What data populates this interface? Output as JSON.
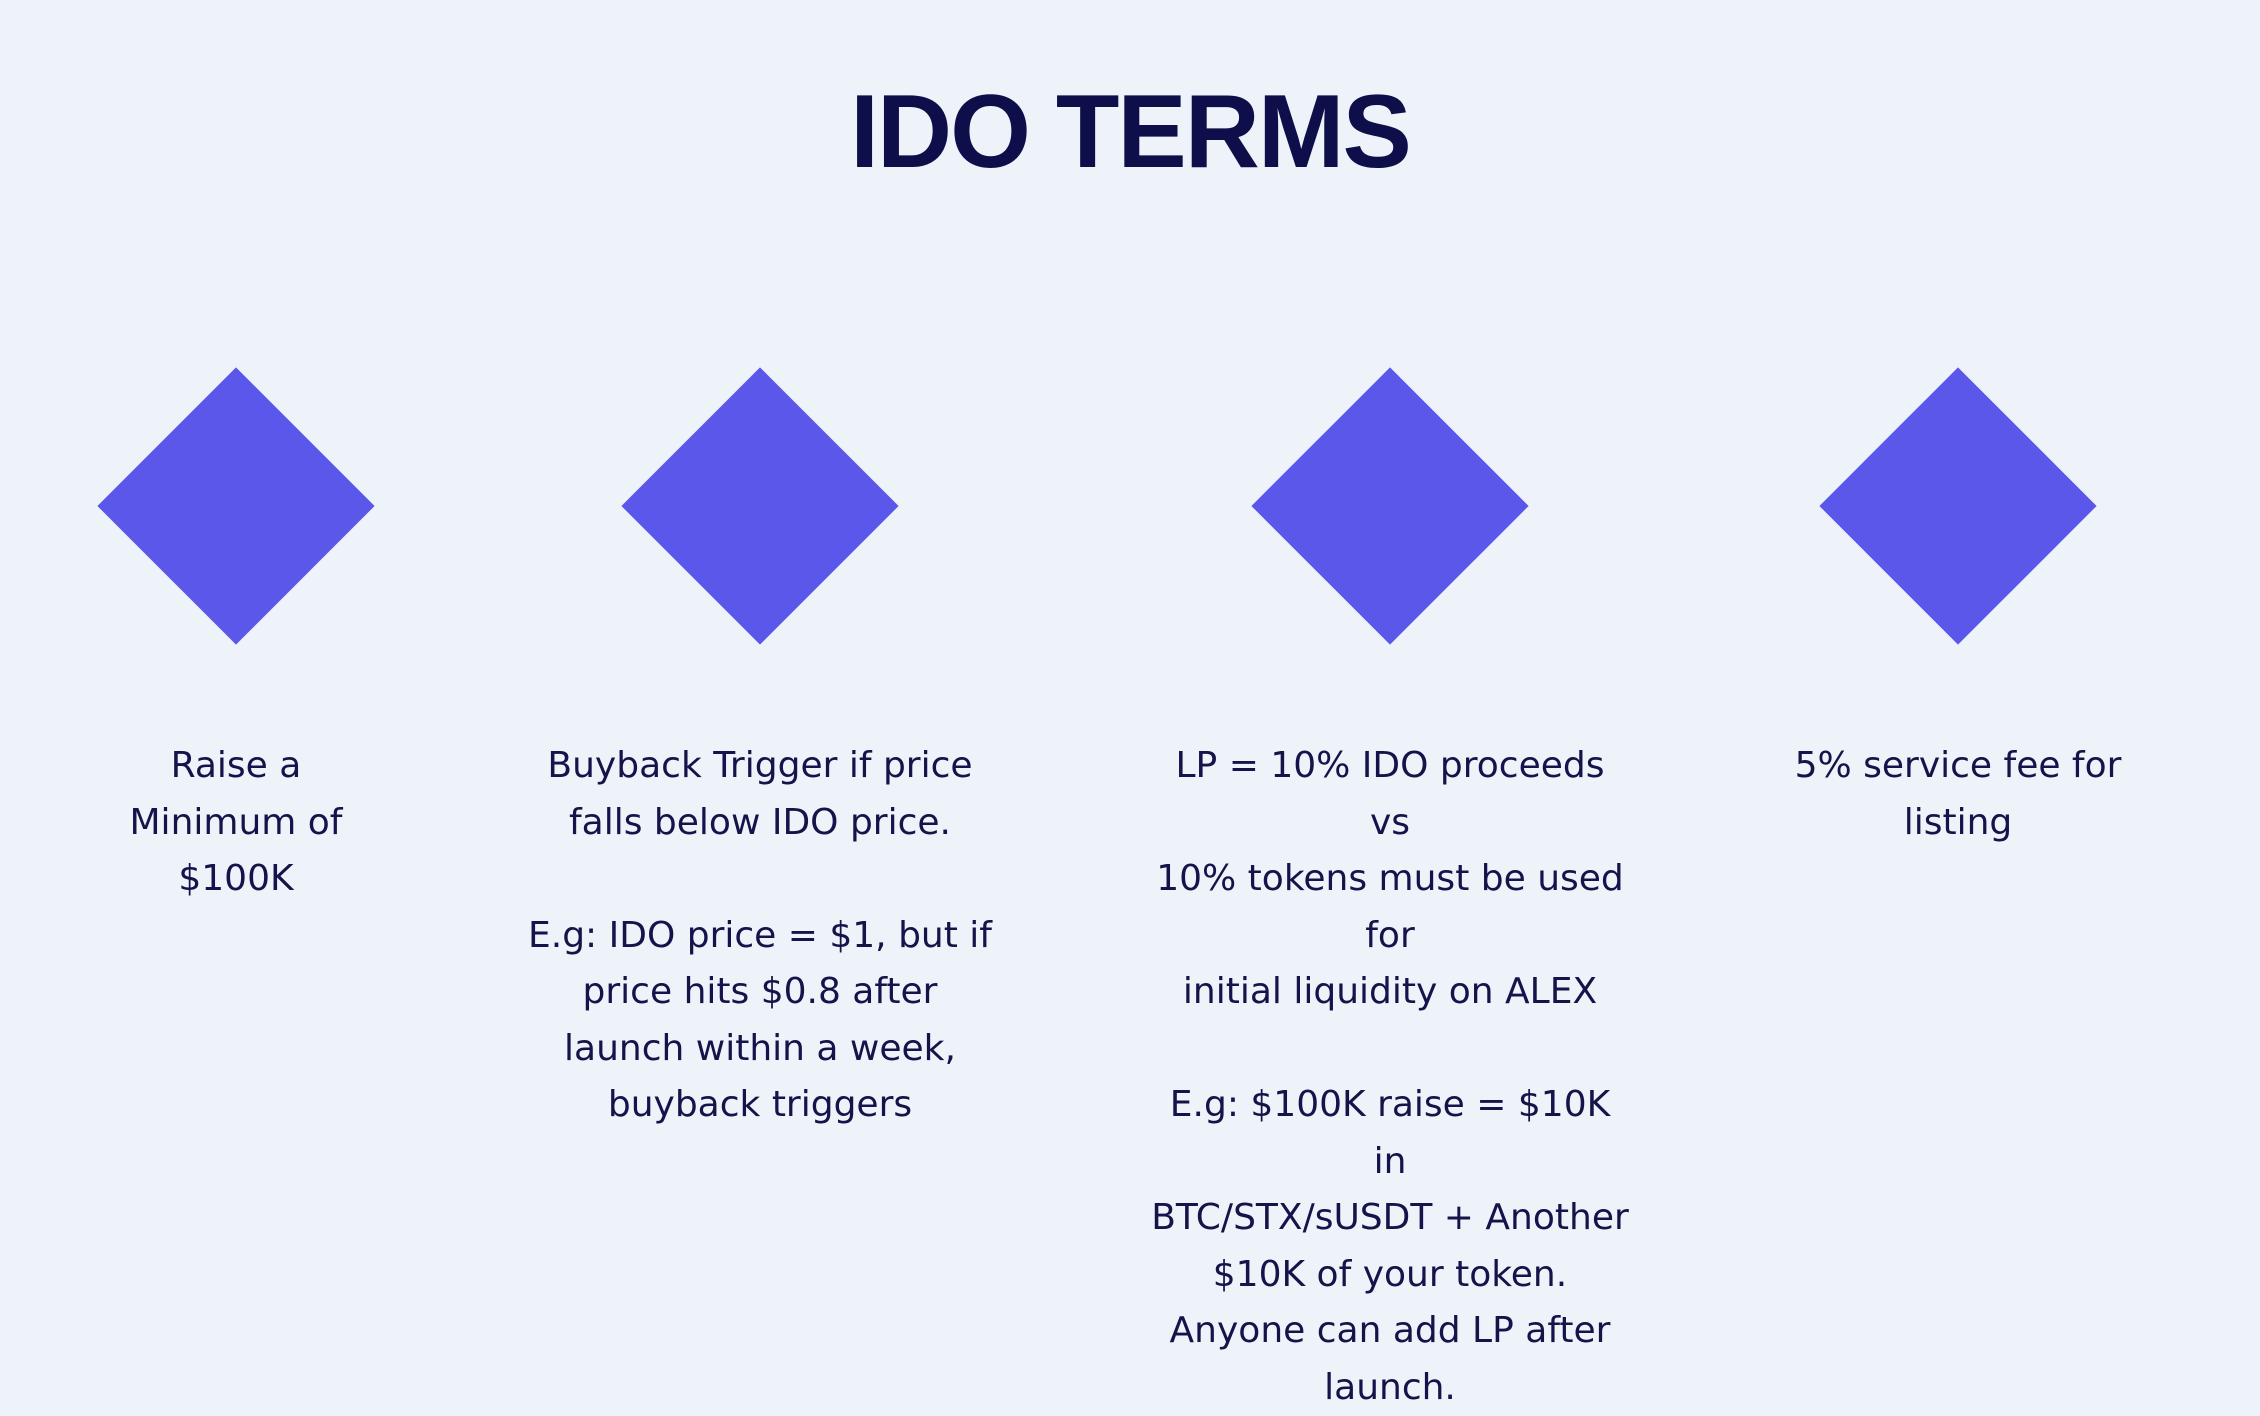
{
  "title": "IDO TERMS",
  "accent_color": "#5b57ea",
  "background_color": "#eef3fa",
  "terms": [
    {
      "icon": "diamond-icon",
      "text": "Raise a\nMinimum of\n$100K"
    },
    {
      "icon": "diamond-icon",
      "text": "Buyback Trigger if price\nfalls below IDO price.\n\nE.g: IDO price = $1, but if\nprice hits $0.8 after\nlaunch within a week,\nbuyback triggers"
    },
    {
      "icon": "diamond-icon",
      "text": "LP = 10% IDO proceeds vs\n10% tokens must be used for\ninitial liquidity on ALEX\n\nE.g: $100K raise = $10K in\nBTC/STX/sUSDT + Another\n$10K of your token.\nAnyone can add LP after\nlaunch."
    },
    {
      "icon": "diamond-icon",
      "text": "5% service fee for\nlisting"
    }
  ]
}
